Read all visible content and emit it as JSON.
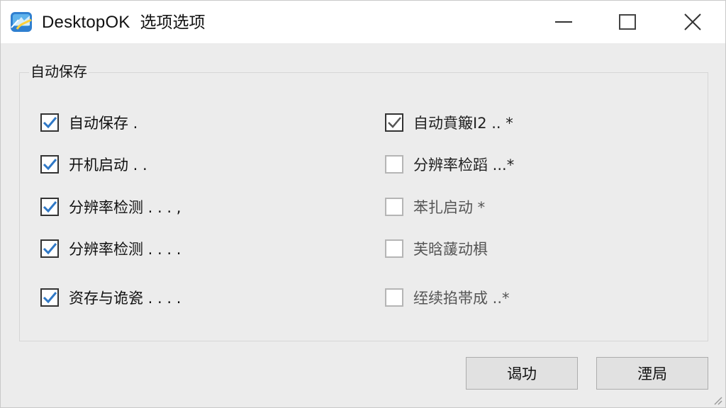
{
  "window": {
    "app_name": "DesktopOK",
    "subtitle": "选项选项",
    "icon": "desktopok-app-icon",
    "controls": {
      "minimize_icon": "minimize-icon",
      "maximize_icon": "maximize-icon",
      "close_icon": "close-icon"
    }
  },
  "group": {
    "label": "自动保存"
  },
  "left_options": [
    {
      "label": "自动保存          .",
      "checked": true
    },
    {
      "label": "开机启动    .    .",
      "checked": true
    },
    {
      "label": "分辨率检测 . . . ,",
      "checked": true
    },
    {
      "label": "分辨率检测 . . . .",
      "checked": true
    },
    {
      "label": "资存与诡瓷 . . . .",
      "checked": true
    }
  ],
  "right_options": [
    {
      "label": "自动賁簸I2 .. *",
      "checked": true,
      "disabled": true
    },
    {
      "label": "分辨率检蹈 ...*",
      "checked": false
    },
    {
      "label": "苯扎启动    *",
      "checked": false
    },
    {
      "label": "芙晗蘐动椇",
      "checked": false
    },
    {
      "label": "绖续掐帯成 ..*",
      "checked": false
    }
  ],
  "buttons": {
    "ok_label": "谒功",
    "cancel_label": "湮局"
  },
  "colors": {
    "check_blue": "#2f78c6",
    "check_gray": "#555555",
    "titlebar_bg": "#ffffff",
    "dialog_bg": "#ececec"
  }
}
